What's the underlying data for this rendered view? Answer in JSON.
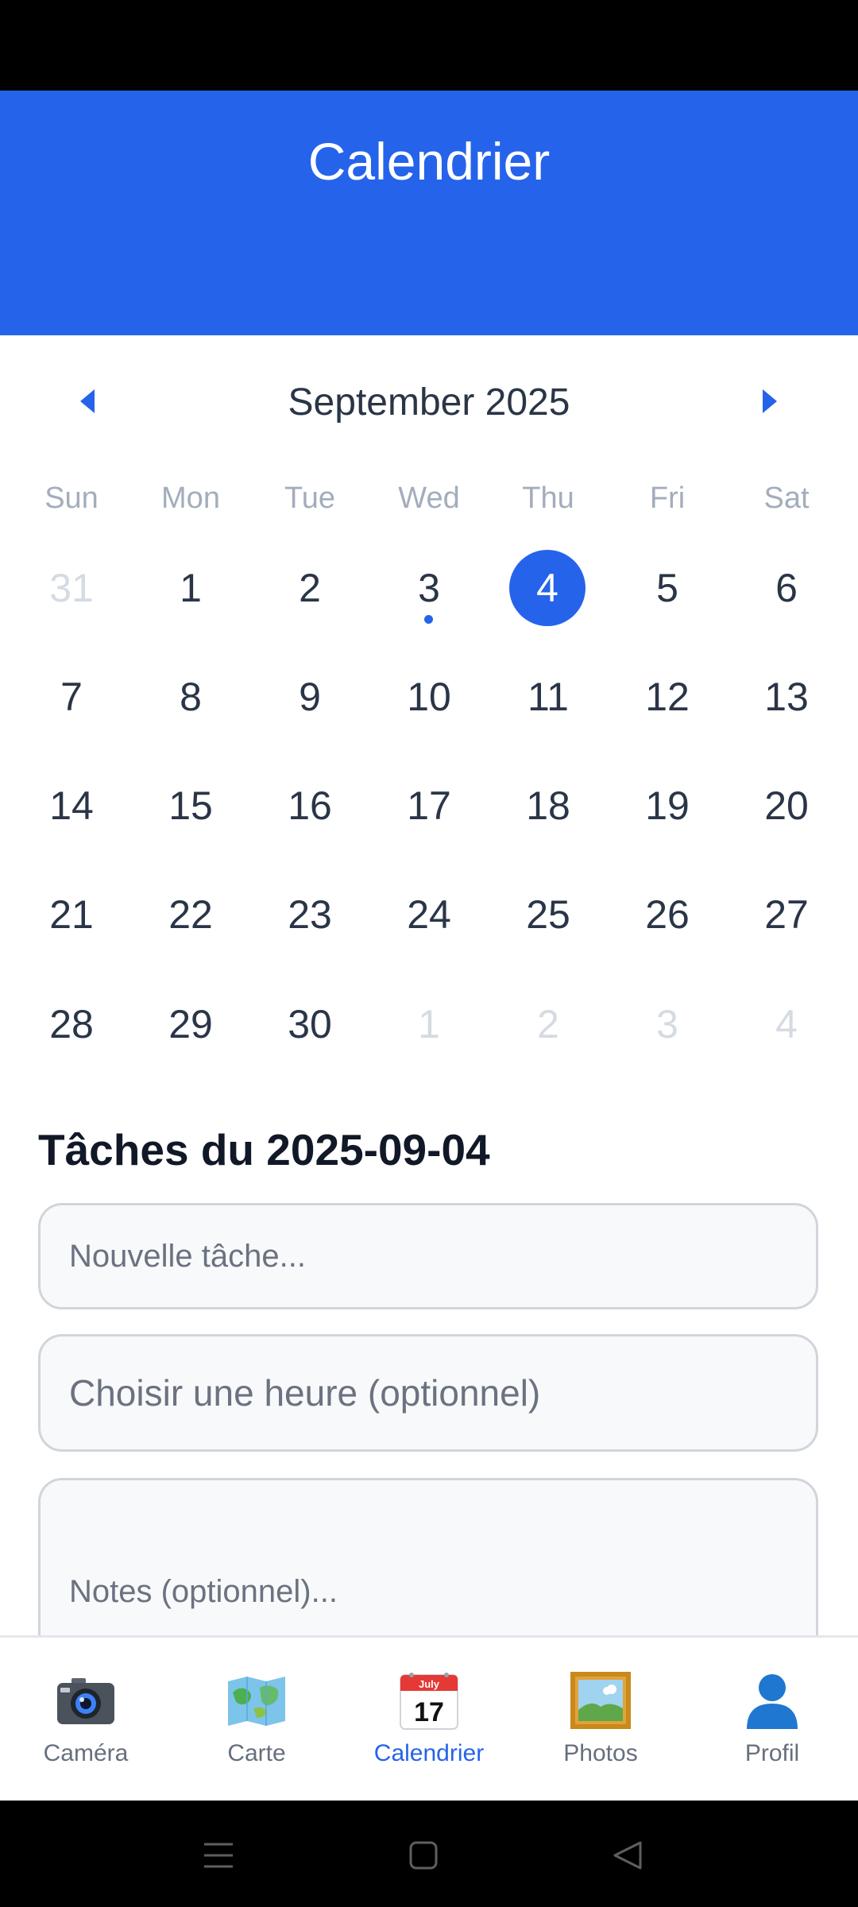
{
  "header": {
    "title": "Calendrier"
  },
  "calendar": {
    "month_label": "September 2025",
    "weekdays": [
      "Sun",
      "Mon",
      "Tue",
      "Wed",
      "Thu",
      "Fri",
      "Sat"
    ],
    "weeks": [
      [
        "31",
        "1",
        "2",
        "3",
        "4",
        "5",
        "6"
      ],
      [
        "7",
        "8",
        "9",
        "10",
        "11",
        "12",
        "13"
      ],
      [
        "14",
        "15",
        "16",
        "17",
        "18",
        "19",
        "20"
      ],
      [
        "21",
        "22",
        "23",
        "24",
        "25",
        "26",
        "27"
      ],
      [
        "28",
        "29",
        "30",
        "1",
        "2",
        "3",
        "4"
      ]
    ],
    "selected_day": "4",
    "days_with_events": [
      "3"
    ],
    "colors": {
      "accent": "#2563eb",
      "muted": "#d5dbe3"
    }
  },
  "tasks": {
    "title": "Tâches du 2025-09-04",
    "title_placeholder": "Nouvelle tâche...",
    "time_placeholder": "Choisir une heure (optionnel)",
    "notes_placeholder": "Notes (optionnel)..."
  },
  "bottom_nav": {
    "items": [
      {
        "label": "Caméra",
        "icon": "camera-icon"
      },
      {
        "label": "Carte",
        "icon": "map-icon"
      },
      {
        "label": "Calendrier",
        "icon": "calendar-icon",
        "icon_month": "July",
        "icon_day": "17",
        "active": true
      },
      {
        "label": "Photos",
        "icon": "framed-picture-icon"
      },
      {
        "label": "Profil",
        "icon": "person-icon"
      }
    ]
  }
}
